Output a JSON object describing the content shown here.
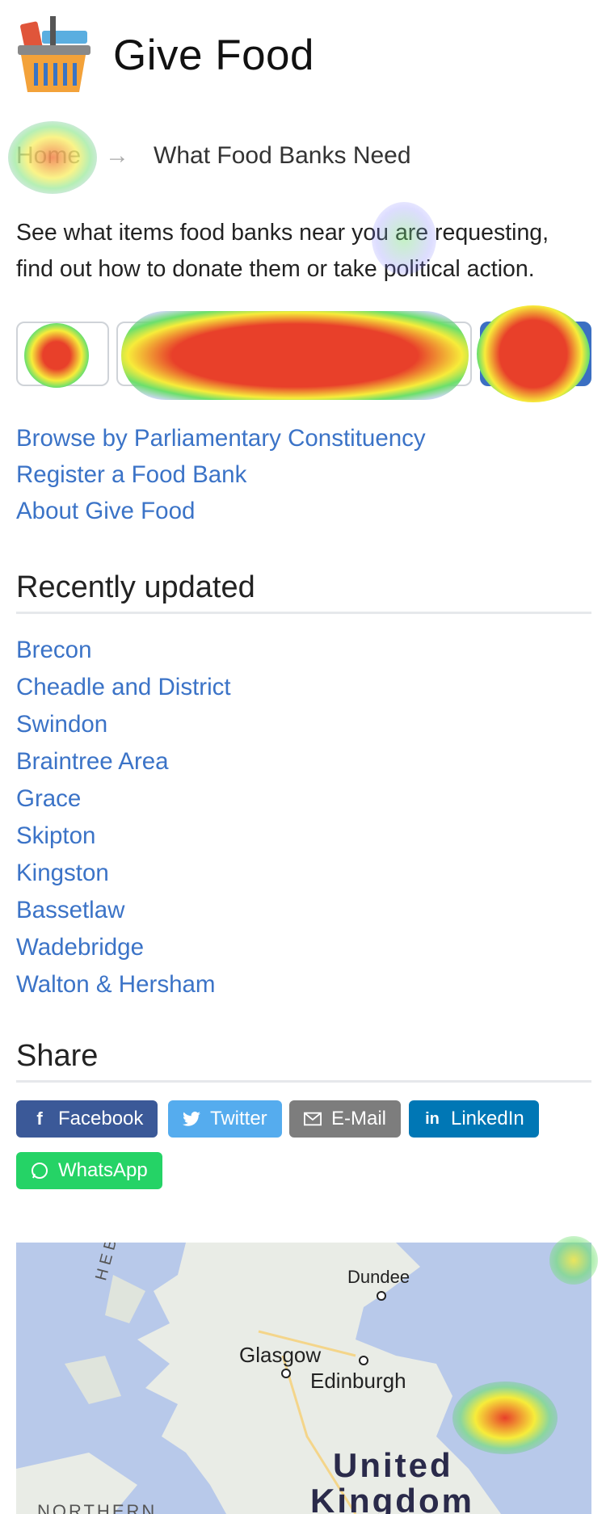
{
  "header": {
    "title": "Give Food"
  },
  "breadcrumb": {
    "home": "Home",
    "arrow": "→",
    "current": "What Food Banks Need"
  },
  "intro": "See what items food banks near you are requesting, find out how to donate them or take political action.",
  "search": {
    "placeholder": ""
  },
  "links": [
    "Browse by Parliamentary Constituency",
    "Register a Food Bank",
    "About Give Food"
  ],
  "recent": {
    "title": "Recently updated",
    "items": [
      "Brecon",
      "Cheadle and District",
      "Swindon",
      "Braintree Area",
      "Grace",
      "Skipton",
      "Kingston",
      "Bassetlaw",
      "Wadebridge",
      "Walton & Hersham"
    ]
  },
  "share": {
    "title": "Share",
    "buttons": [
      {
        "label": "Facebook",
        "icon": "facebook-icon",
        "color": "#3b5998"
      },
      {
        "label": "Twitter",
        "icon": "twitter-icon",
        "color": "#55acee"
      },
      {
        "label": "E-Mail",
        "icon": "mail-icon",
        "color": "#7d7d7d"
      },
      {
        "label": "LinkedIn",
        "icon": "linkedin-icon",
        "color": "#0077b5"
      },
      {
        "label": "WhatsApp",
        "icon": "whatsapp-icon",
        "color": "#25d366"
      }
    ]
  },
  "map": {
    "labels": {
      "heb": "H E B",
      "dundee": "Dundee",
      "glasgow": "Glasgow",
      "edinburgh": "Edinburgh",
      "uk1": "United",
      "uk2": "Kingdom",
      "ni": "NORTHERN"
    }
  },
  "colors": {
    "link": "#3b73c7",
    "accent": "#3b6fc2"
  }
}
